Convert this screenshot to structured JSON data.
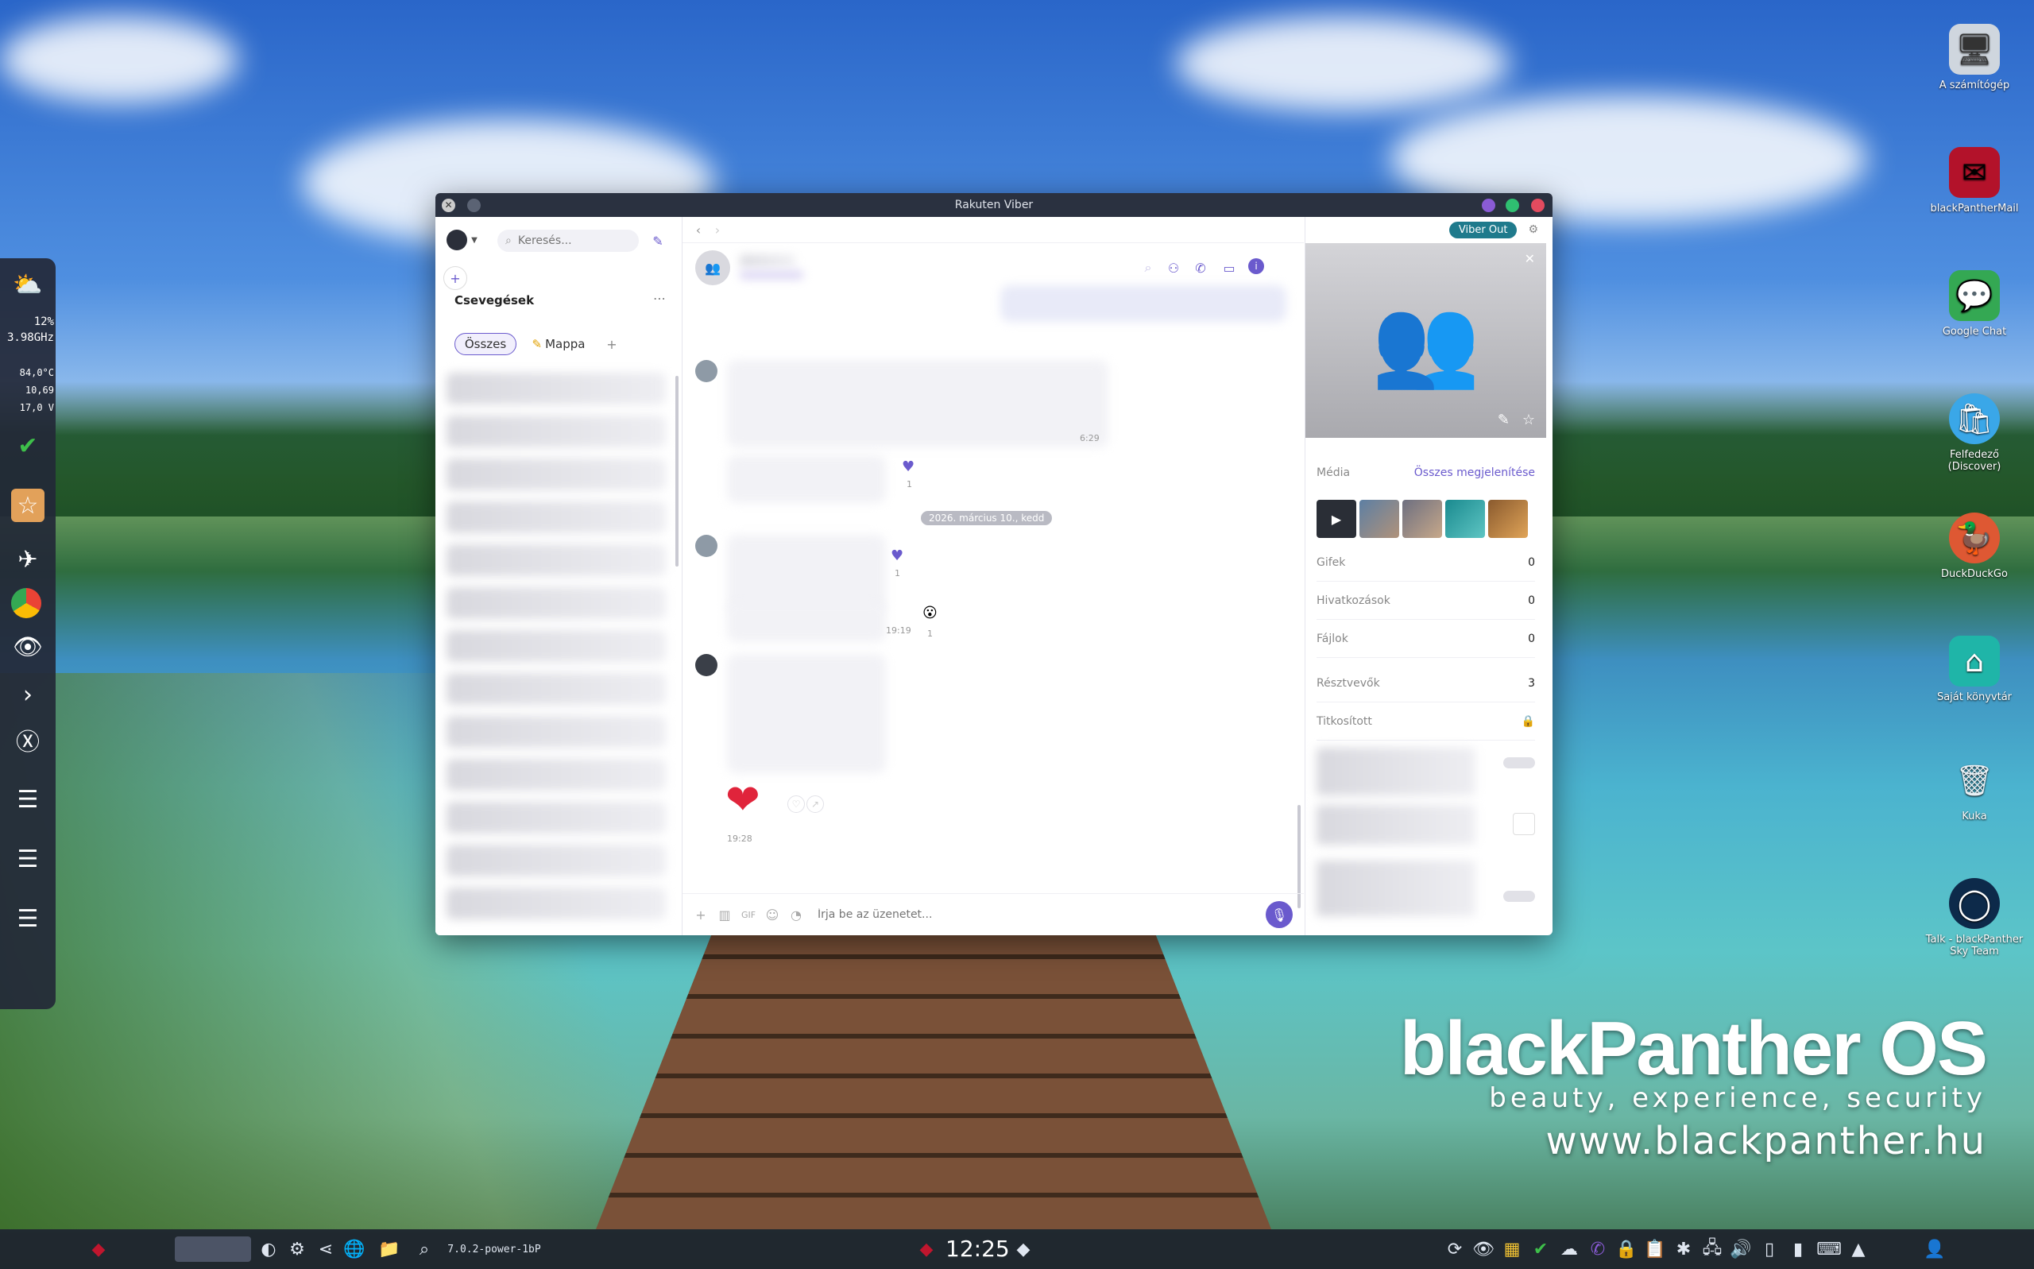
{
  "window": {
    "title": "Rakuten Viber",
    "search_placeholder": "Keresés...",
    "chats_title": "Csevegések",
    "filter_all": "Összes",
    "filter_folder": "Mappa",
    "viber_out": "Viber Out",
    "date_divider": "2026. március 10., kedd",
    "times": [
      "6:29",
      "19:19",
      "19:28"
    ],
    "reaction_counts": [
      "1",
      "1",
      "1"
    ],
    "input_placeholder": "Írja be az üzenetet..."
  },
  "info_panel": {
    "media_label": "Média",
    "media_link": "Összes megjelenítése",
    "rows": [
      {
        "label": "Gifek",
        "value": "0"
      },
      {
        "label": "Hivatkozások",
        "value": "0"
      },
      {
        "label": "Fájlok",
        "value": "0"
      },
      {
        "label": "Résztvevők",
        "value": "3"
      },
      {
        "label": "Titkosított",
        "value": ""
      }
    ]
  },
  "left_panel": {
    "cpu_load": "12%",
    "cpu_freq": "3.98GHz",
    "temp": "84,0°C",
    "val2": "10,69",
    "voltage": "17,0 V"
  },
  "desktop_icons": [
    {
      "label": "A számítógép"
    },
    {
      "label": "blackPantherMail"
    },
    {
      "label": "Google Chat"
    },
    {
      "label": "Felfedező (Discover)"
    },
    {
      "label": "DuckDuckGo"
    },
    {
      "label": "Saját könyvtár"
    },
    {
      "label": "Kuka"
    },
    {
      "label": "Talk - blackPanther Sky Team"
    }
  ],
  "branding": {
    "name": "blackPanther OS",
    "tagline": "beauty, experience, security",
    "url": "www.blackpanther.hu"
  },
  "taskbar": {
    "clock": "12:25",
    "power_profile": "7.0.2-power-1bP"
  },
  "colors": {
    "accent": "#6a5acd",
    "viber_out_bg": "#1f7a8c",
    "titlebar": "#2a3140"
  }
}
